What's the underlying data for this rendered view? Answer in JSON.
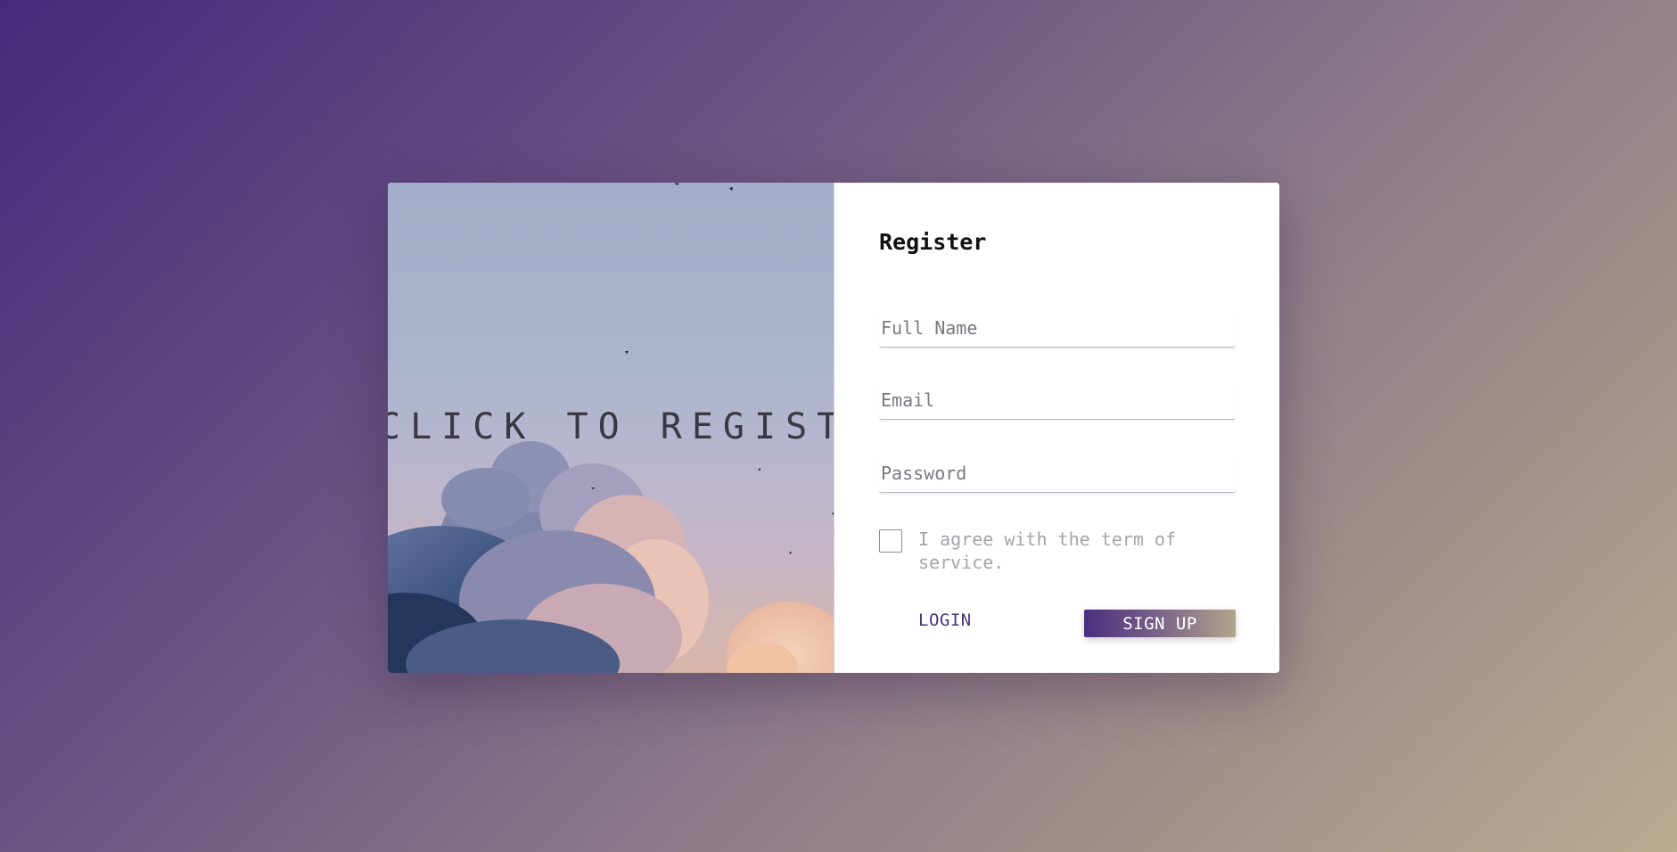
{
  "image_panel": {
    "caption": "CLICK TO REGISTER",
    "image_name": "sky-clouds-birds-photo"
  },
  "form": {
    "title": "Register",
    "full_name": {
      "placeholder": "Full Name",
      "value": ""
    },
    "email": {
      "placeholder": "Email",
      "value": ""
    },
    "password": {
      "placeholder": "Password",
      "value": ""
    },
    "terms": {
      "label": "I agree with the term of service.",
      "checked": false
    },
    "login_label": "LOGIN",
    "signup_label": "SIGN UP"
  },
  "colors": {
    "accent": "#4a3480",
    "gradient_start": "#452a7a",
    "gradient_end": "#b9ab8f"
  }
}
